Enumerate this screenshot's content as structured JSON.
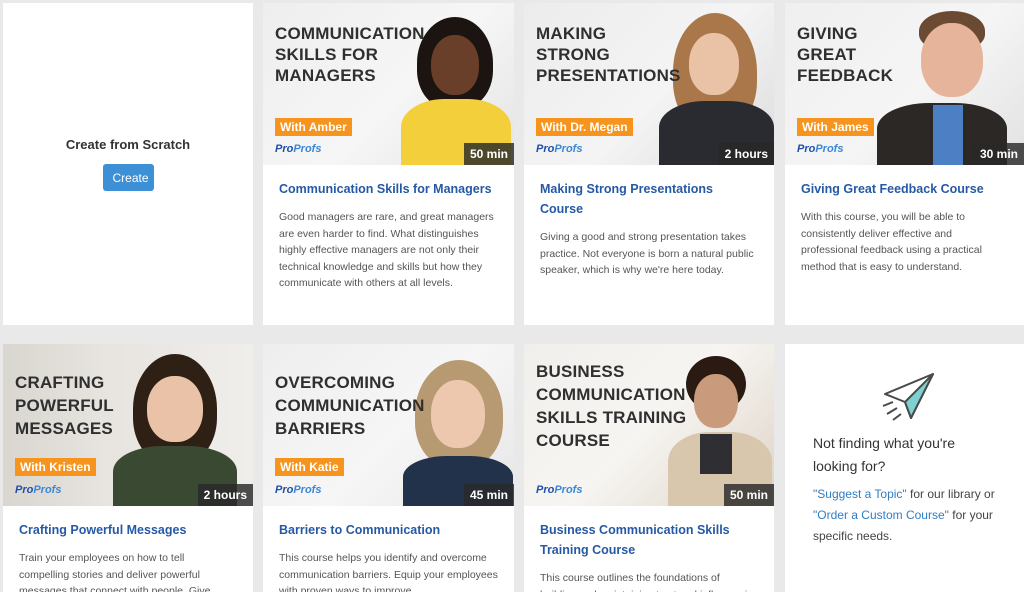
{
  "scratch": {
    "title": "Create from Scratch",
    "button": "Create"
  },
  "courses": [
    {
      "thumb_title": "COMMUNICATION\nSKILLS FOR\nMANAGERS",
      "with": "With Amber",
      "duration": "50 min",
      "title": "Communication Skills for Managers",
      "desc": "Good managers are rare, and great managers are even harder to find. What distinguishes highly effective managers are not only their technical knowledge and skills but how they communicate with others at all levels."
    },
    {
      "thumb_title": "MAKING\nSTRONG\nPRESENTATIONS",
      "with": "With Dr. Megan",
      "duration": "2 hours",
      "title": "Making Strong Presentations Course",
      "desc": "Giving a good and strong presentation takes practice. Not everyone is born a natural public speaker, which is why we're here today."
    },
    {
      "thumb_title": "GIVING\nGREAT\nFEEDBACK",
      "with": "With James",
      "duration": "30 min",
      "title": "Giving Great Feedback Course",
      "desc": "With this course, you will be able to consistently deliver effective and professional feedback using a practical method that is easy to understand."
    },
    {
      "thumb_title": "CRAFTING\nPOWERFUL\nMESSAGES",
      "with": "With Kristen",
      "duration": "2 hours",
      "title": "Crafting Powerful Messages",
      "desc": "Train your employees on how to tell compelling stories and deliver powerful messages that connect with people. Give"
    },
    {
      "thumb_title": "OVERCOMING\nCOMMUNICATION\nBARRIERS",
      "with": "With Katie",
      "duration": "45 min",
      "title": "Barriers to Communication",
      "desc": "This course helps you identify and overcome communication barriers. Equip your employees with proven ways to improve"
    },
    {
      "thumb_title": "BUSINESS\nCOMMUNICATION\nSKILLS TRAINING\nCOURSE",
      "with": "",
      "duration": "50 min",
      "title": "Business Communication Skills Training Course",
      "desc": "This course outlines the foundations of building and maintaining trust and influence in"
    }
  ],
  "logo": {
    "pro": "Pro",
    "profs": "Profs"
  },
  "not_finding": {
    "icon": "paper-plane-icon",
    "title": "Not finding what you're looking for?",
    "link1": "\"Suggest a Topic\"",
    "text1": " for our library or ",
    "link2": "\"Order a Custom Course\"",
    "text2": " for your specific needs."
  },
  "colors": {
    "accent": "#3d8fd6",
    "tag": "#f7941d",
    "title_link": "#2659a5"
  }
}
